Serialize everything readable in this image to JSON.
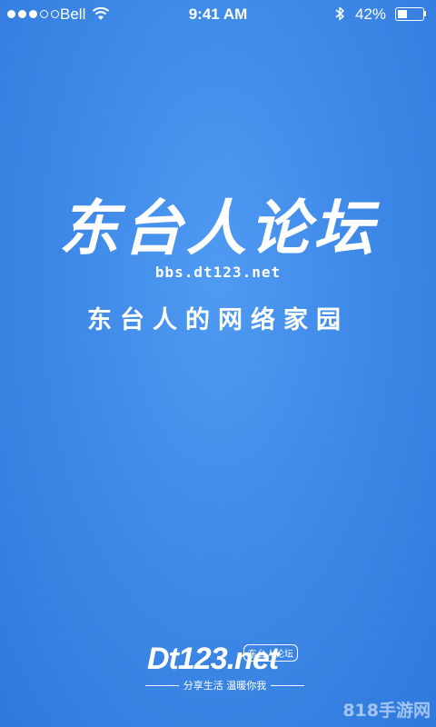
{
  "status_bar": {
    "carrier": "Bell",
    "time": "9:41 AM",
    "battery_percent": "42%",
    "battery_level": 0.42,
    "signal_strength_of_5": 3
  },
  "splash": {
    "title": "东台人论坛",
    "url": "bbs.dt123.net",
    "slogan": "东台人的网络家园"
  },
  "logo": {
    "wordmark": "Dt123.net",
    "badge": "东台人论坛",
    "tagline": "分享生活 温暖你我"
  },
  "watermark": "818手游网"
}
